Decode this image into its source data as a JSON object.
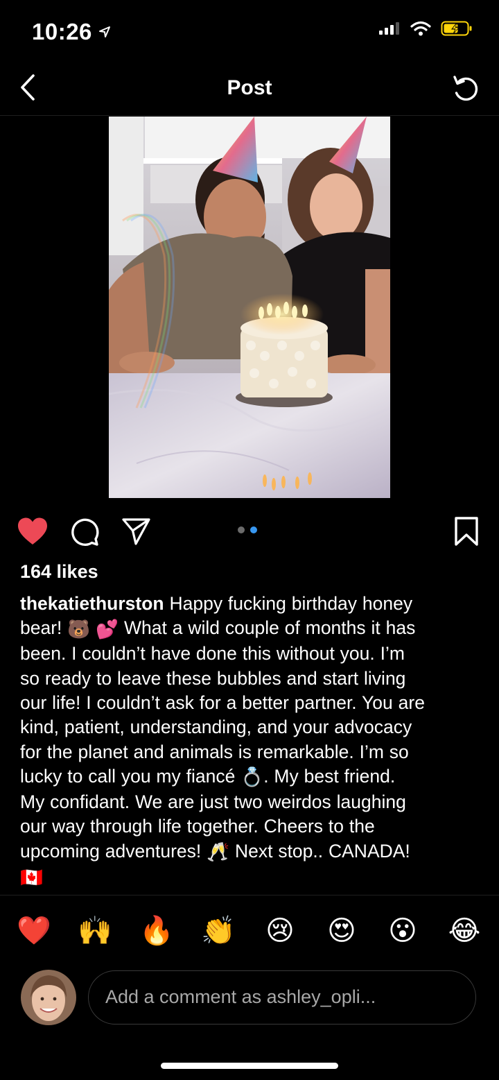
{
  "status_bar": {
    "time": "10:26"
  },
  "header": {
    "title": "Post"
  },
  "post": {
    "likes": "164 likes",
    "username": "thekatiethurston",
    "caption_lines": [
      " Happy fucking birthday honey",
      "bear! ",
      " What a wild couple of months it has",
      "been. I couldn’t have done this without you. I’m",
      "so ready to leave these bubbles and start living",
      "our life! I couldn’t ask for a better partner. You are",
      "kind, patient, understanding, and your advocacy",
      "for the planet and animals is remarkable. I’m so",
      "lucky to call you my fiancé ",
      ". My best friend.",
      "My confidant. We are just two weirdos laughing",
      "our way through life together. Cheers to the",
      "upcoming adventures! ",
      "  Next stop.. CANADA!"
    ],
    "caption_emojis": {
      "bear": "🐻",
      "hearts": "💕",
      "ring": "💍",
      "cheers": "🥂",
      "flag": "🇨🇦"
    },
    "carousel": {
      "total": 2,
      "active_index": 1
    }
  },
  "reactions": [
    "❤️",
    "🙌",
    "🔥",
    "👏",
    "😢",
    "😍",
    "😮",
    "😂"
  ],
  "comment": {
    "placeholder": "Add a comment as ashley_opli..."
  },
  "colors": {
    "background": "#000000",
    "like_red": "#ED4956",
    "dot_active": "#3897F0",
    "dot_inactive": "#6b6b6b",
    "battery_charging": "#FFD60A"
  },
  "icons": {
    "back": "chevron-left-icon",
    "refresh": "refresh-icon",
    "like": "heart-icon",
    "comment": "comment-icon",
    "share": "send-icon",
    "save": "bookmark-icon"
  }
}
